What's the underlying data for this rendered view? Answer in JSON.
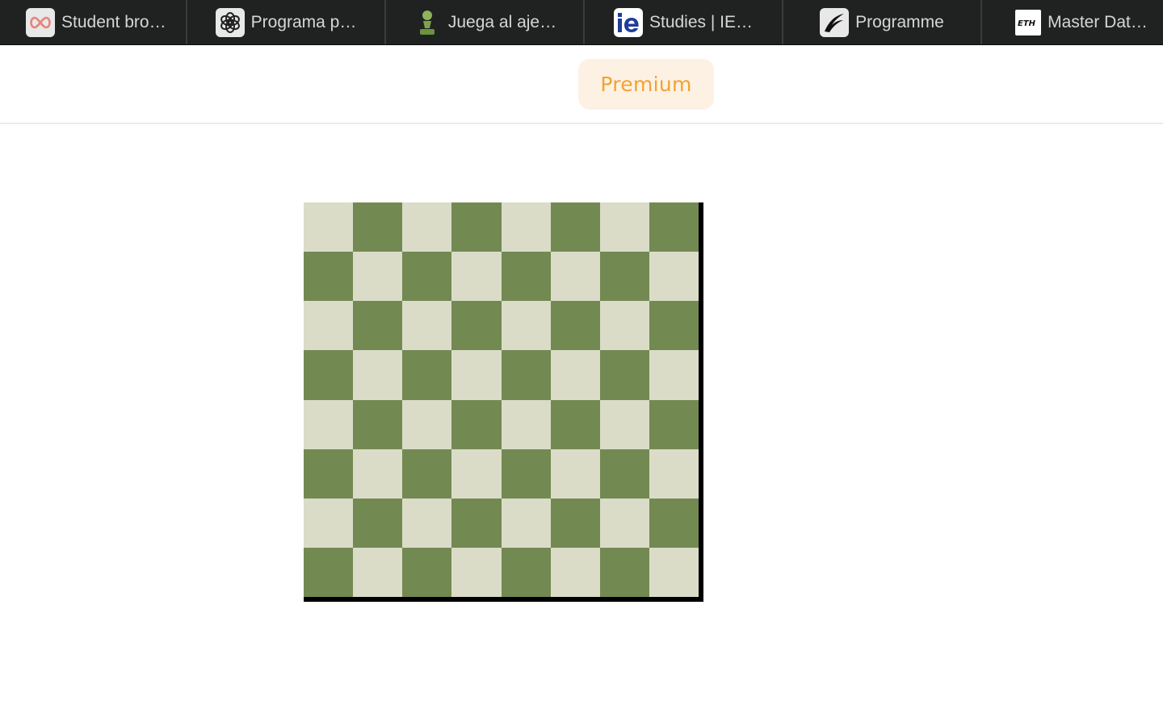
{
  "browser": {
    "tabs": [
      {
        "title": "Student bro…",
        "icon": "infinity-loop-icon"
      },
      {
        "title": "Programa p…",
        "icon": "openai-knot-icon"
      },
      {
        "title": "Juega al aje…",
        "icon": "chess-pawn-icon"
      },
      {
        "title": "Studies | IE…",
        "icon": "ie-logo-icon"
      },
      {
        "title": "Programme",
        "icon": "swoosh-logo-icon"
      },
      {
        "title": "Master Dat…",
        "icon": "eth-logo-icon"
      }
    ]
  },
  "header": {
    "premium_label": "Premium"
  },
  "board": {
    "rows": 8,
    "cols": 8,
    "light_color": "#dadcc8",
    "dark_color": "#738952",
    "top_left": "light"
  },
  "colors": {
    "tab_strip": "#202221",
    "premium_text": "#f1a332",
    "premium_bg": "#fdf1e4"
  }
}
